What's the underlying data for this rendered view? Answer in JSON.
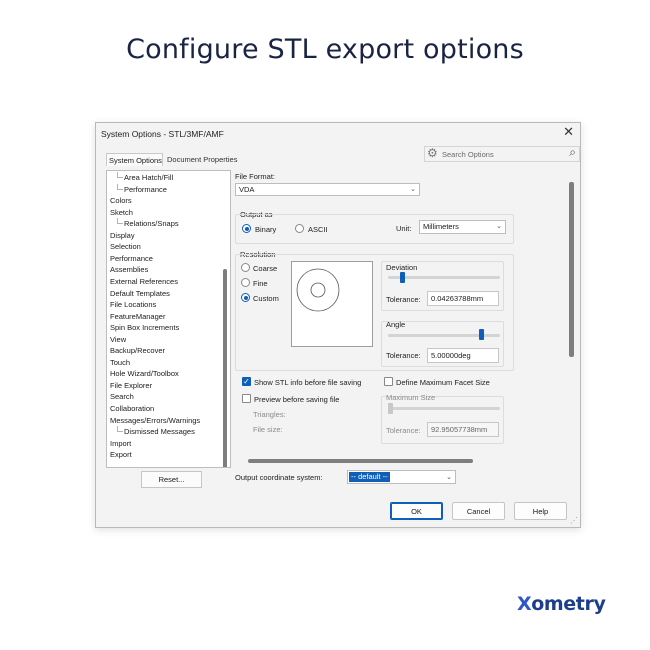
{
  "headline": "Configure STL export options",
  "dialog": {
    "title": "System Options - STL/3MF/AMF",
    "close_glyph": "✕",
    "tabs": [
      "System Options",
      "Document Properties"
    ],
    "search_placeholder": "Search Options",
    "tree_items": [
      {
        "label": "Area Hatch/Fill",
        "child": true
      },
      {
        "label": "Performance",
        "child": true
      },
      {
        "label": "Colors",
        "child": false
      },
      {
        "label": "Sketch",
        "child": false
      },
      {
        "label": "Relations/Snaps",
        "child": true
      },
      {
        "label": "Display",
        "child": false
      },
      {
        "label": "Selection",
        "child": false
      },
      {
        "label": "Performance",
        "child": false
      },
      {
        "label": "Assemblies",
        "child": false
      },
      {
        "label": "External References",
        "child": false
      },
      {
        "label": "Default Templates",
        "child": false
      },
      {
        "label": "File Locations",
        "child": false
      },
      {
        "label": "FeatureManager",
        "child": false
      },
      {
        "label": "Spin Box Increments",
        "child": false
      },
      {
        "label": "View",
        "child": false
      },
      {
        "label": "Backup/Recover",
        "child": false
      },
      {
        "label": "Touch",
        "child": false
      },
      {
        "label": "Hole Wizard/Toolbox",
        "child": false
      },
      {
        "label": "File Explorer",
        "child": false
      },
      {
        "label": "Search",
        "child": false
      },
      {
        "label": "Collaboration",
        "child": false
      },
      {
        "label": "Messages/Errors/Warnings",
        "child": false
      },
      {
        "label": "Dismissed Messages",
        "child": true
      },
      {
        "label": "Import",
        "child": false
      },
      {
        "label": "Export",
        "child": false
      }
    ],
    "reset_label": "Reset...",
    "file_format": {
      "label": "File Format:",
      "value": "VDA"
    },
    "output_as": {
      "label": "Output as",
      "binary": "Binary",
      "ascii": "ASCII",
      "selected": "Binary",
      "unit_label": "Unit:",
      "unit_value": "Millimeters"
    },
    "resolution": {
      "label": "Resolution",
      "options": [
        "Coarse",
        "Fine",
        "Custom"
      ],
      "selected": "Custom",
      "deviation": {
        "label": "Deviation",
        "tolerance_label": "Tolerance:",
        "value": "0.04263788mm",
        "slider_fraction": 0.11
      },
      "angle": {
        "label": "Angle",
        "tolerance_label": "Tolerance:",
        "value": "5.00000deg",
        "slider_fraction": 0.85
      }
    },
    "show_info": {
      "label": "Show STL info before file saving",
      "checked": true
    },
    "preview": {
      "label": "Preview before saving file",
      "checked": false,
      "triangles_label": "Triangles:",
      "file_size_label": "File size:"
    },
    "max_facet": {
      "label": "Define Maximum Facet Size",
      "checked": false
    },
    "max_size": {
      "label": "Maximum Size",
      "tolerance_label": "Tolerance:",
      "value": "92.95057738mm",
      "slider_fraction": 0.0
    },
    "coordinate": {
      "label": "Output coordinate system:",
      "value": "-- default --"
    },
    "buttons": {
      "ok": "OK",
      "cancel": "Cancel",
      "help": "Help"
    }
  },
  "logo": {
    "x": "X",
    "rest": "ometry"
  },
  "colors": {
    "accent": "#0f5fb8",
    "headline": "#1a2344",
    "logo": "#1e3e8c"
  }
}
